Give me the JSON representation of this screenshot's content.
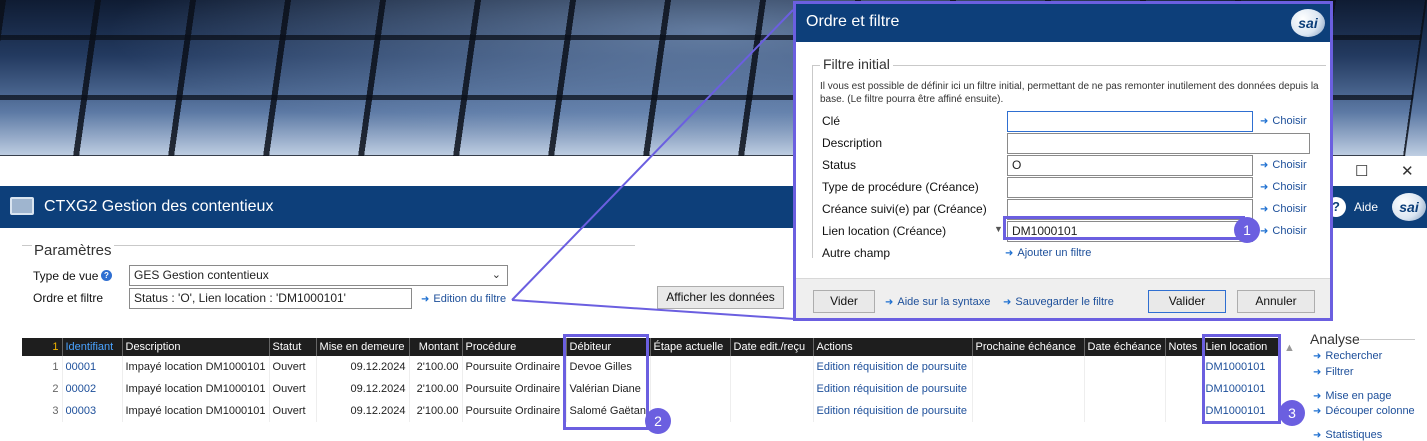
{
  "window": {
    "app_title": "CTXG2 Gestion des contentieux",
    "help_label": "Aide",
    "logo_text": "sai",
    "minimize": "—",
    "maximize": "☐",
    "close": "✕"
  },
  "params": {
    "legend": "Paramètres",
    "view_type_label": "Type de vue",
    "view_type_value": "GES Gestion contentieux",
    "order_filter_label": "Ordre et filtre",
    "order_filter_value": "Status : 'O', Lien location : 'DM1000101'",
    "edit_filter_link": "Edition du filtre",
    "show_data_button": "Afficher les données"
  },
  "table": {
    "sort_indicator": "1",
    "columns": [
      "Identifiant",
      "Description",
      "Statut",
      "Mise en demeure",
      "Montant",
      "Procédure",
      "Débiteur",
      "Étape actuelle",
      "Date edit./reçu",
      "Actions",
      "Prochaine échéance",
      "Date échéance",
      "Notes",
      "Lien location"
    ],
    "rows": [
      {
        "num": "1",
        "id": "00001",
        "description": "Impayé location DM1000101",
        "status": "Ouvert",
        "notice_date": "09.12.2024",
        "amount": "2'100.00",
        "procedure": "Poursuite Ordinaire",
        "debtor": "Devoe Gilles",
        "step": "",
        "edit_date": "",
        "action": "Edition réquisition de poursuite",
        "next_deadline": "",
        "deadline_date": "",
        "notes": "",
        "rental_link": "DM1000101"
      },
      {
        "num": "2",
        "id": "00002",
        "description": "Impayé location DM1000101",
        "status": "Ouvert",
        "notice_date": "09.12.2024",
        "amount": "2'100.00",
        "procedure": "Poursuite Ordinaire",
        "debtor": "Valérian Diane",
        "step": "",
        "edit_date": "",
        "action": "Edition réquisition de poursuite",
        "next_deadline": "",
        "deadline_date": "",
        "notes": "",
        "rental_link": "DM1000101"
      },
      {
        "num": "3",
        "id": "00003",
        "description": "Impayé location DM1000101",
        "status": "Ouvert",
        "notice_date": "09.12.2024",
        "amount": "2'100.00",
        "procedure": "Poursuite Ordinaire",
        "debtor": "Salomé Gaëtan",
        "step": "",
        "edit_date": "",
        "action": "Edition réquisition de poursuite",
        "next_deadline": "",
        "deadline_date": "",
        "notes": "",
        "rental_link": "DM1000101"
      }
    ]
  },
  "side_panel": {
    "title": "Analyse",
    "items": [
      "Rechercher",
      "Filtrer",
      "Mise en page",
      "Découper colonne",
      "Statistiques"
    ]
  },
  "dialog": {
    "title": "Ordre et filtre",
    "legend": "Filtre initial",
    "description": "Il vous est possible de définir ici un filtre initial, permettant de ne pas remonter inutilement des données depuis la base. (Le filtre pourra être affiné ensuite).",
    "fields": [
      {
        "label": "Clé",
        "value": "",
        "action": "Choisir"
      },
      {
        "label": "Description",
        "value": "",
        "action": ""
      },
      {
        "label": "Status",
        "value": "O",
        "action": "Choisir"
      },
      {
        "label": "Type de procédure (Créance)",
        "value": "",
        "action": "Choisir"
      },
      {
        "label": "Créance suivi(e) par (Créance)",
        "value": "",
        "action": "Choisir"
      },
      {
        "label": "Lien location (Créance)",
        "value": "DM1000101",
        "action": "Choisir"
      }
    ],
    "other_field_label": "Autre champ",
    "add_filter_link": "Ajouter un filtre",
    "footer": {
      "clear_button": "Vider",
      "syntax_help_link": "Aide sur la syntaxe",
      "save_filter_link": "Sauvegarder le filtre",
      "validate_button": "Valider",
      "cancel_button": "Annuler"
    }
  },
  "callouts": [
    "1",
    "2",
    "3"
  ],
  "colors": {
    "accent": "#6b5fe0",
    "header_blue": "#0d3f7a",
    "link_blue": "#1d4f9a"
  }
}
